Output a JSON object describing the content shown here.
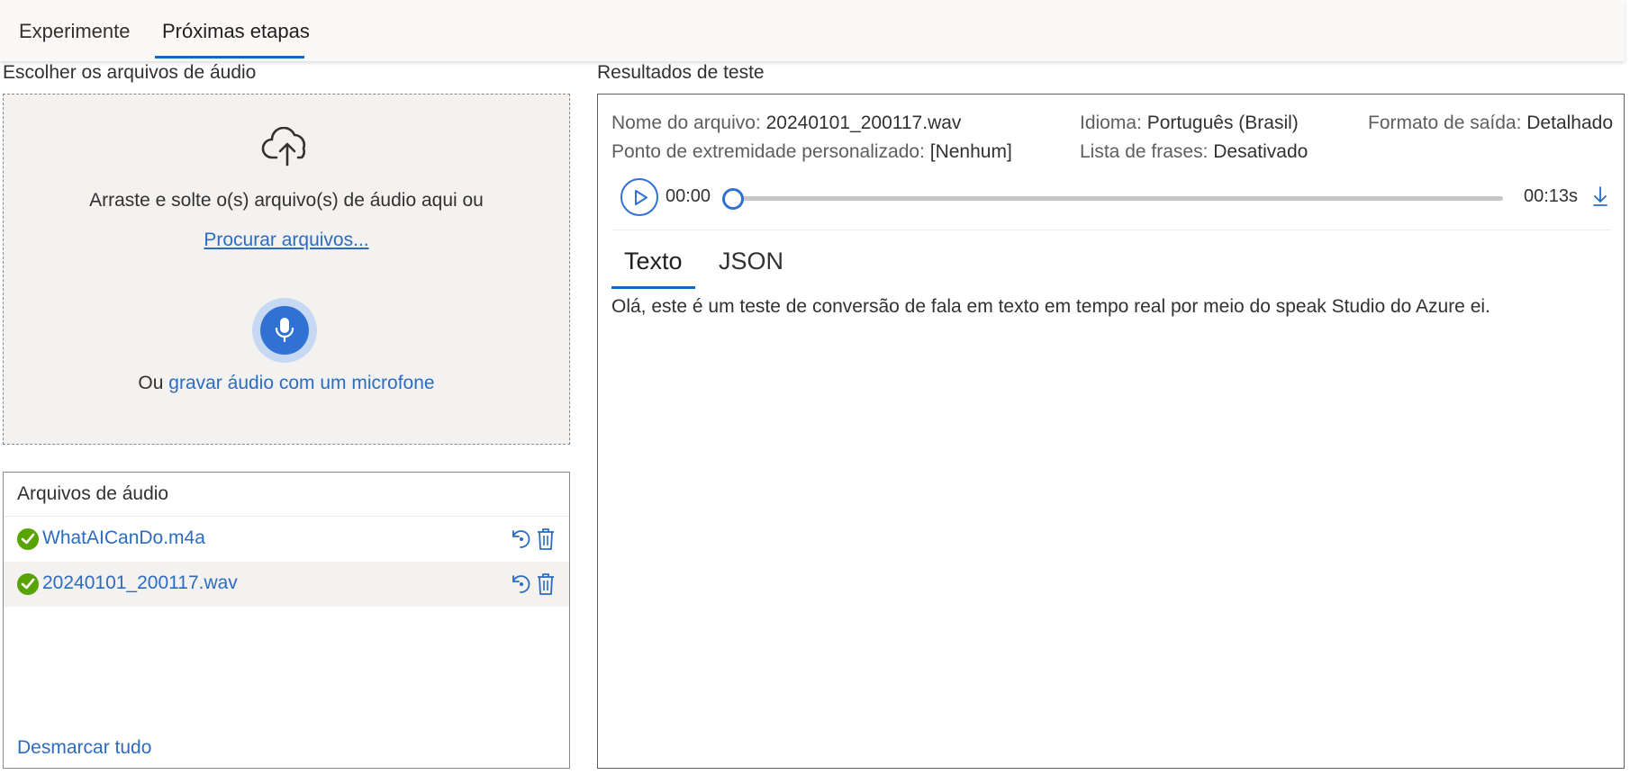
{
  "tabs": [
    {
      "label": "Experimente"
    },
    {
      "label": "Próximas etapas",
      "active": true
    }
  ],
  "upload": {
    "section_title": "Escolher os arquivos de áudio",
    "drop_text": "Arraste e solte o(s) arquivo(s) de áudio aqui ou",
    "browse_link": "Procurar arquivos...",
    "record_prefix": "Ou",
    "record_link": "gravar áudio com um microfone",
    "icons": [
      "cloud-upload-icon",
      "microphone-icon"
    ]
  },
  "files": {
    "title": "Arquivos de áudio",
    "items": [
      {
        "name": "WhatAICanDo.m4a",
        "status": "success",
        "selected": false
      },
      {
        "name": "20240101_200117.wav",
        "status": "success",
        "selected": true
      }
    ],
    "deselect_all": "Desmarcar tudo"
  },
  "results": {
    "section_title": "Resultados de teste",
    "filename_label": "Nome do arquivo:",
    "filename_value": "20240101_200117.wav",
    "endpoint_label": "Ponto de extremidade personalizado:",
    "endpoint_value": "[Nenhum]",
    "language_label": "Idioma:",
    "language_value": "Português (Brasil)",
    "phrase_list_label": "Lista de frases:",
    "phrase_list_value": "Desativado",
    "output_format_label": "Formato de saída:",
    "output_format_value": "Detalhado",
    "player": {
      "current_time": "00:00",
      "total_time": "00:13s",
      "progress": 0
    },
    "tabs": [
      {
        "label": "Texto",
        "active": true
      },
      {
        "label": "JSON"
      }
    ],
    "transcript": "Olá, este é um teste de conversão de fala em texto em tempo real por meio do speak Studio do Azure ei."
  },
  "colors": {
    "accent": "#2f72d4",
    "link": "#2b6cc2",
    "success": "#57a300"
  }
}
